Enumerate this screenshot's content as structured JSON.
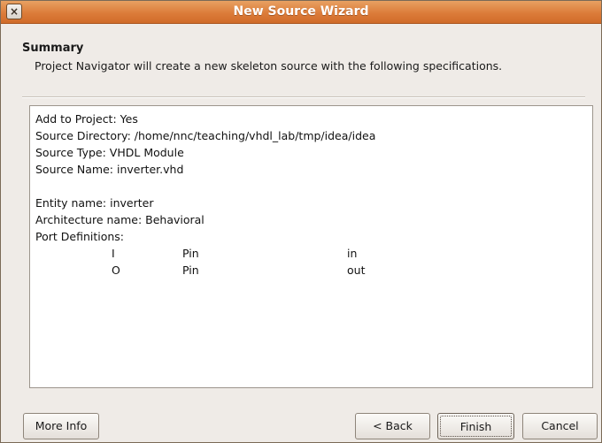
{
  "window": {
    "title": "New Source Wizard",
    "close_glyph": "×"
  },
  "summary": {
    "heading": "Summary",
    "description": "Project Navigator will create a new skeleton source with the following specifications."
  },
  "spec": {
    "add_to_project": "Add to Project: Yes",
    "source_directory": "Source Directory: /home/nnc/teaching/vhdl_lab/tmp/idea/idea",
    "source_type": "Source Type: VHDL Module",
    "source_name": "Source Name: inverter.vhd",
    "entity_name": "Entity name: inverter",
    "architecture_name": "Architecture name: Behavioral",
    "port_definitions_label": "Port Definitions:",
    "ports": [
      {
        "name": "I",
        "type": "Pin",
        "direction": "in"
      },
      {
        "name": "O",
        "type": "Pin",
        "direction": "out"
      }
    ]
  },
  "buttons": {
    "more_info": "More Info",
    "back": "< Back",
    "finish": "Finish",
    "cancel": "Cancel"
  },
  "icons": {
    "close": "close-icon"
  }
}
